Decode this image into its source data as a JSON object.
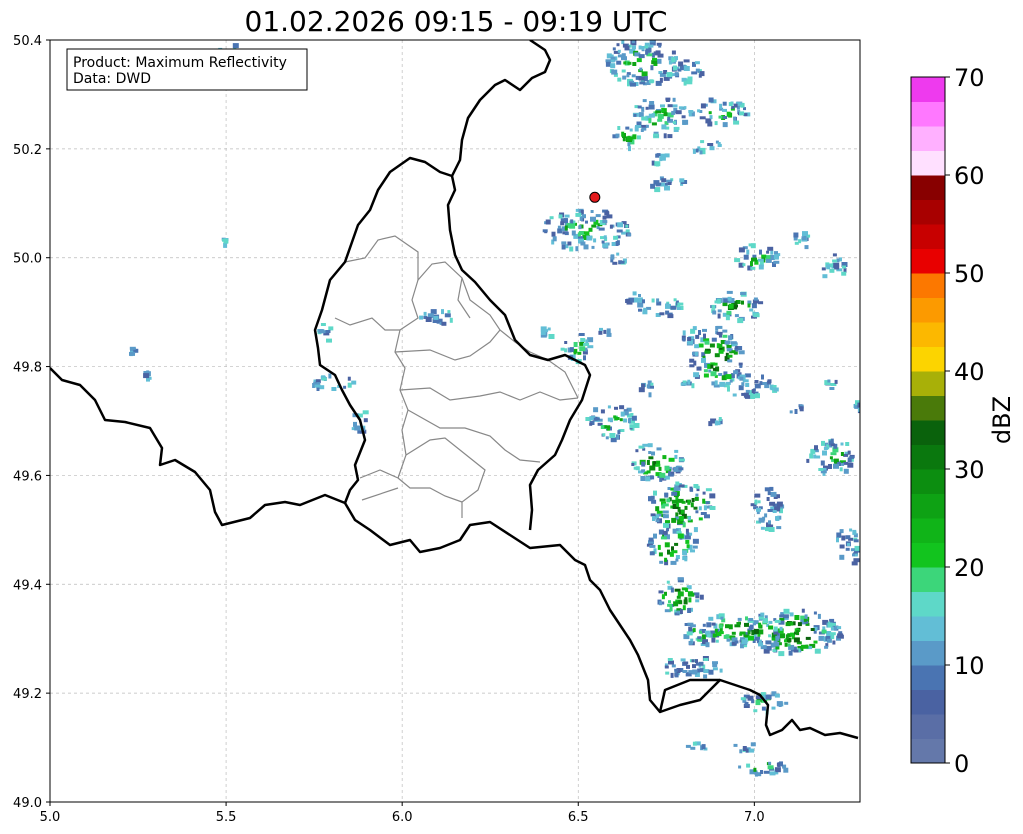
{
  "title": "01.02.2026 09:15 - 09:19 UTC",
  "info_box": {
    "product_line": "Product: Maximum Reflectivity",
    "data_line": "Data: DWD"
  },
  "map": {
    "x_ticks": [
      "5.0",
      "5.5",
      "6.0",
      "6.5",
      "7.0"
    ],
    "y_ticks": [
      "49.0",
      "49.2",
      "49.4",
      "49.6",
      "49.8",
      "50.0",
      "50.2",
      "50.4"
    ],
    "xlim": [
      5.0,
      7.3
    ],
    "ylim": [
      49.0,
      50.4
    ],
    "grid": true,
    "marker": {
      "lon": 6.547,
      "lat": 50.111,
      "color": "#e31a1c"
    }
  },
  "colorbar": {
    "label": "dBZ",
    "ticks": [
      "0",
      "10",
      "20",
      "30",
      "40",
      "50",
      "60",
      "70"
    ],
    "range": [
      0,
      70
    ],
    "step": 2.5,
    "colors": [
      "#6478aa",
      "#5a6ea6",
      "#4a62a2",
      "#4a74b2",
      "#5a9ac8",
      "#62bed6",
      "#5ed8c8",
      "#3cd67a",
      "#12c41e",
      "#10b418",
      "#0ea214",
      "#0c8e10",
      "#0a780e",
      "#0a620c",
      "#4a7a0a",
      "#a8b008",
      "#fcd400",
      "#fcb800",
      "#fc9a00",
      "#fc7800",
      "#e80000",
      "#c80000",
      "#a80000",
      "#880000",
      "#ffe0ff",
      "#ffb0ff",
      "#ff78ff",
      "#ee3aee"
    ]
  }
}
